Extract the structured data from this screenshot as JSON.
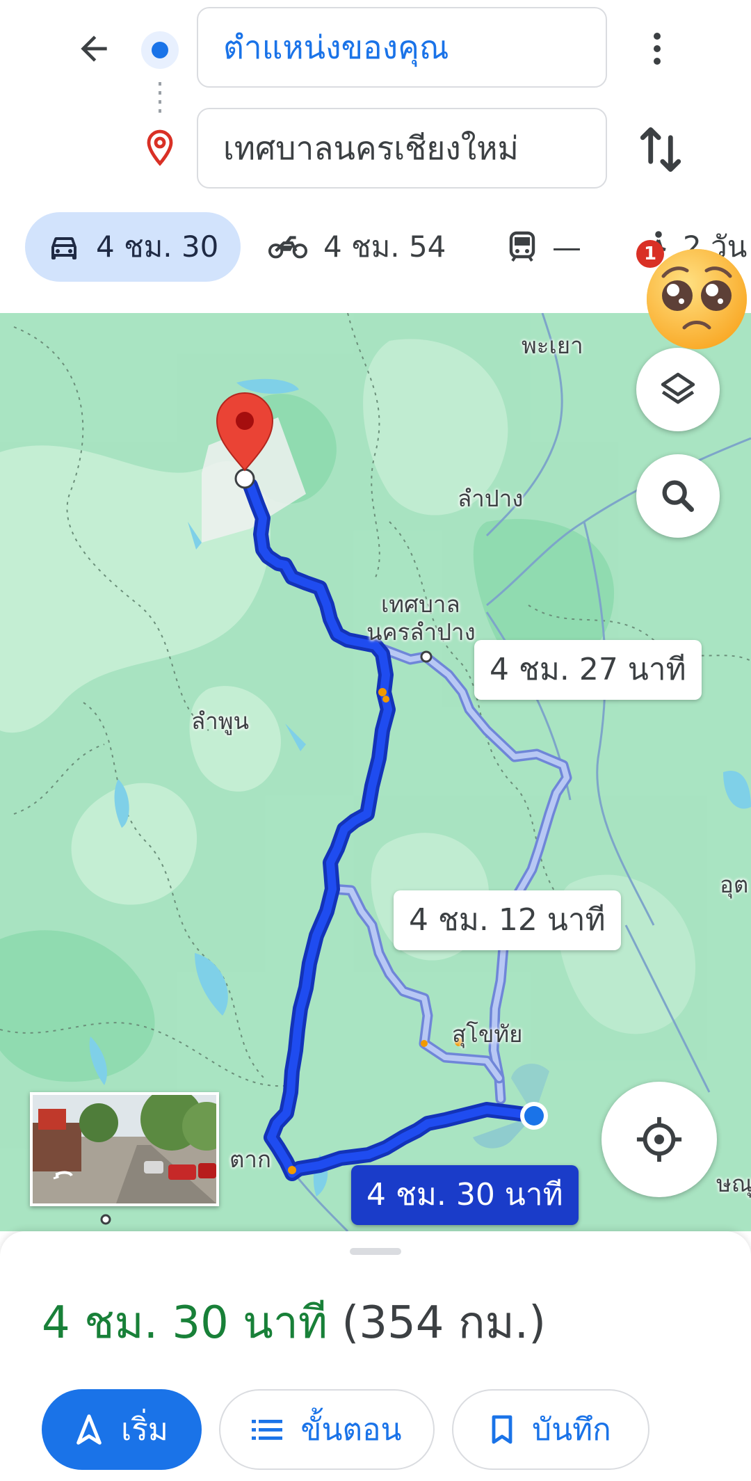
{
  "header": {
    "origin_value": "ตำแหน่งของคุณ",
    "destination_value": "เทศบาลนครเชียงใหม่"
  },
  "modes": [
    {
      "name": "car",
      "label": "4 ชม. 30",
      "active": true
    },
    {
      "name": "motorbike",
      "label": "4 ชม. 54"
    },
    {
      "name": "transit",
      "label": "—"
    },
    {
      "name": "walk",
      "label": "2 วัน"
    }
  ],
  "notification_count": "1",
  "map": {
    "places": {
      "phayao": "พะเยา",
      "lampang": "ลำปาง",
      "lampang_city_1": "เทศบาล",
      "lampang_city_2": "นครลำปาง",
      "lamphun": "ลำพูน",
      "sukhothai": "สุโขทัย",
      "tak": "ตาก",
      "uttaradit_partial": "อุต",
      "phitsanulok_partial": "ษณุ"
    },
    "route_callouts": {
      "alt1": "4 ชม. 27 นาที",
      "alt2": "4 ชม. 12 นาที",
      "selected": "4 ชม. 30 นาที"
    },
    "colors": {
      "route_selected": "#1a3cc9",
      "route_alt": "#9fb3ec",
      "water": "#7fd0e8"
    }
  },
  "sheet": {
    "time": "4 ชม. 30 นาที",
    "distance": "(354 กม.)",
    "start_label": "เริ่ม",
    "steps_label": "ขั้นตอน",
    "save_label": "บันทึก"
  }
}
